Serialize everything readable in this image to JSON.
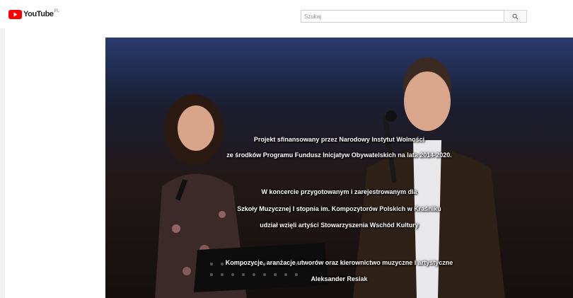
{
  "masthead": {
    "logo_text": "YouTube",
    "logo_region": "PL",
    "search_placeholder": "Szukaj",
    "search_icon": "search-icon"
  },
  "video": {
    "caption_lines": [
      "Projekt sfinansowany przez Narodowy Instytut Wolności",
      "ze środków Programu Fundusz Inicjatyw Obywatelskich na lata 2014-2020.",
      "W koncercie przygotowanym i zarejestrowanym dla",
      "Szkoły Muzycznej I stopnia  im. Kompozytorów Polskich w Kraśniku",
      "udział wzięli artyści Stowarzyszenia Wschód Kultury",
      "Kompozycje, aranżacje utworów oraz kierownictwo muzyczne i artystyczne",
      "Aleksander Resiak"
    ]
  },
  "colors": {
    "brand_red": "#ff0000",
    "page_background": "#f1f1f1",
    "caption_text": "#ffffff"
  }
}
